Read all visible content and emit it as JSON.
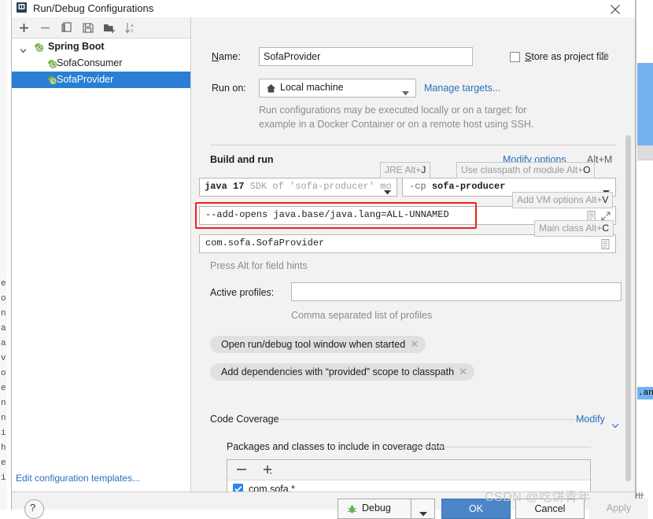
{
  "window": {
    "title": "Run/Debug Configurations",
    "title_icon": "run-debug-icon",
    "close_icon": "close-icon"
  },
  "left_pane": {
    "toolbar": [
      {
        "name": "add-button",
        "icon": "plus-icon",
        "label": "+"
      },
      {
        "name": "remove-button",
        "icon": "minus-icon",
        "label": "−"
      },
      {
        "name": "copy-button",
        "icon": "copy-icon",
        "label": "Copy"
      },
      {
        "name": "save-button",
        "icon": "save-icon",
        "label": "Save"
      },
      {
        "name": "move-into-folder-button",
        "icon": "folder-add-icon",
        "label": "Move into new folder"
      },
      {
        "name": "sort-button",
        "icon": "sort-alpha-icon",
        "label": "Sort configurations"
      }
    ],
    "tree": [
      {
        "label": "Spring Boot",
        "icon": "spring-boot-icon",
        "level": 0,
        "bold": true,
        "expanded": true,
        "selected": false
      },
      {
        "label": "SofaConsumer",
        "icon": "spring-boot-icon",
        "level": 1,
        "bold": false,
        "expanded": null,
        "selected": false
      },
      {
        "label": "SofaProvider",
        "icon": "spring-boot-icon",
        "level": 1,
        "bold": false,
        "expanded": null,
        "selected": true
      }
    ],
    "edit_templates_link": "Edit configuration templates..."
  },
  "right_pane": {
    "name_label": "Name:",
    "name_value": "SofaProvider",
    "store_as_project_file_label": "Store as project file",
    "store_as_project_file_checked": false,
    "store_gear_icon": "gear-icon",
    "run_on_label": "Run on:",
    "run_on_value": "Local machine",
    "run_on_icon": "home-icon",
    "manage_targets_link": "Manage targets...",
    "description_line1": "Run configurations may be executed locally or on a target: for",
    "description_line2": "example in a Docker Container or on a remote host using SSH.",
    "build_and_run_title": "Build and run",
    "modify_options_link": "Modify options",
    "modify_options_shortcut": "Alt+M",
    "hints": {
      "jre": {
        "text": "JRE Alt+",
        "key": "J"
      },
      "classpath": {
        "text": "Use classpath of module Alt+",
        "key": "O"
      },
      "vm_options": {
        "text": "Add VM options Alt+",
        "key": "V"
      },
      "main_class": {
        "text": "Main class Alt+",
        "key": "C"
      }
    },
    "jre_value": "java 17",
    "jre_value_dim": " SDK of 'sofa-producer' mo",
    "classpath_prefix": "-cp",
    "classpath_value": "sofa-producer",
    "vm_options_value": "--add-opens java.base/java.lang=ALL-UNNAMED",
    "vm_options_highlighted": true,
    "highlight_color": "#f02020",
    "main_class_value": "com.sofa.SofaProvider",
    "field_hints_text": "Press Alt for field hints",
    "active_profiles_label": "Active profiles:",
    "active_profiles_value": "",
    "active_profiles_desc": "Comma separated list of profiles",
    "chips": [
      {
        "label": "Open run/debug tool window when started",
        "close_icon": "close-chip-icon"
      },
      {
        "label": "Add dependencies with “provided” scope to classpath",
        "close_icon": "close-chip-icon"
      }
    ],
    "code_coverage_title": "Code Coverage",
    "code_coverage_modify_link": "Modify",
    "packages_section_title": "Packages and classes to include in coverage data",
    "packages_toolbar": [
      {
        "name": "remove-package-button",
        "icon": "minus-icon"
      },
      {
        "name": "add-package-button",
        "icon": "plus-dropdown-icon"
      }
    ],
    "packages": [
      {
        "label": "com.sofa.*",
        "checked": true
      }
    ]
  },
  "bottom_bar": {
    "help_label": "?",
    "debug_label": "Debug",
    "debug_icon": "bug-icon",
    "debug_dropdown_icon": "chevron-down-icon",
    "ok_label": "OK",
    "cancel_label": "Cancel",
    "apply_label": "Apply"
  },
  "watermark": "CSDN @吃饼青年",
  "background": {
    "left_chars": [
      "e",
      "o",
      "n",
      "a",
      "a",
      "v",
      "o",
      "e",
      "n",
      "n",
      "i",
      "h",
      "e",
      "i"
    ],
    "right_snippet": ".ang",
    "right_cjk": "世"
  }
}
